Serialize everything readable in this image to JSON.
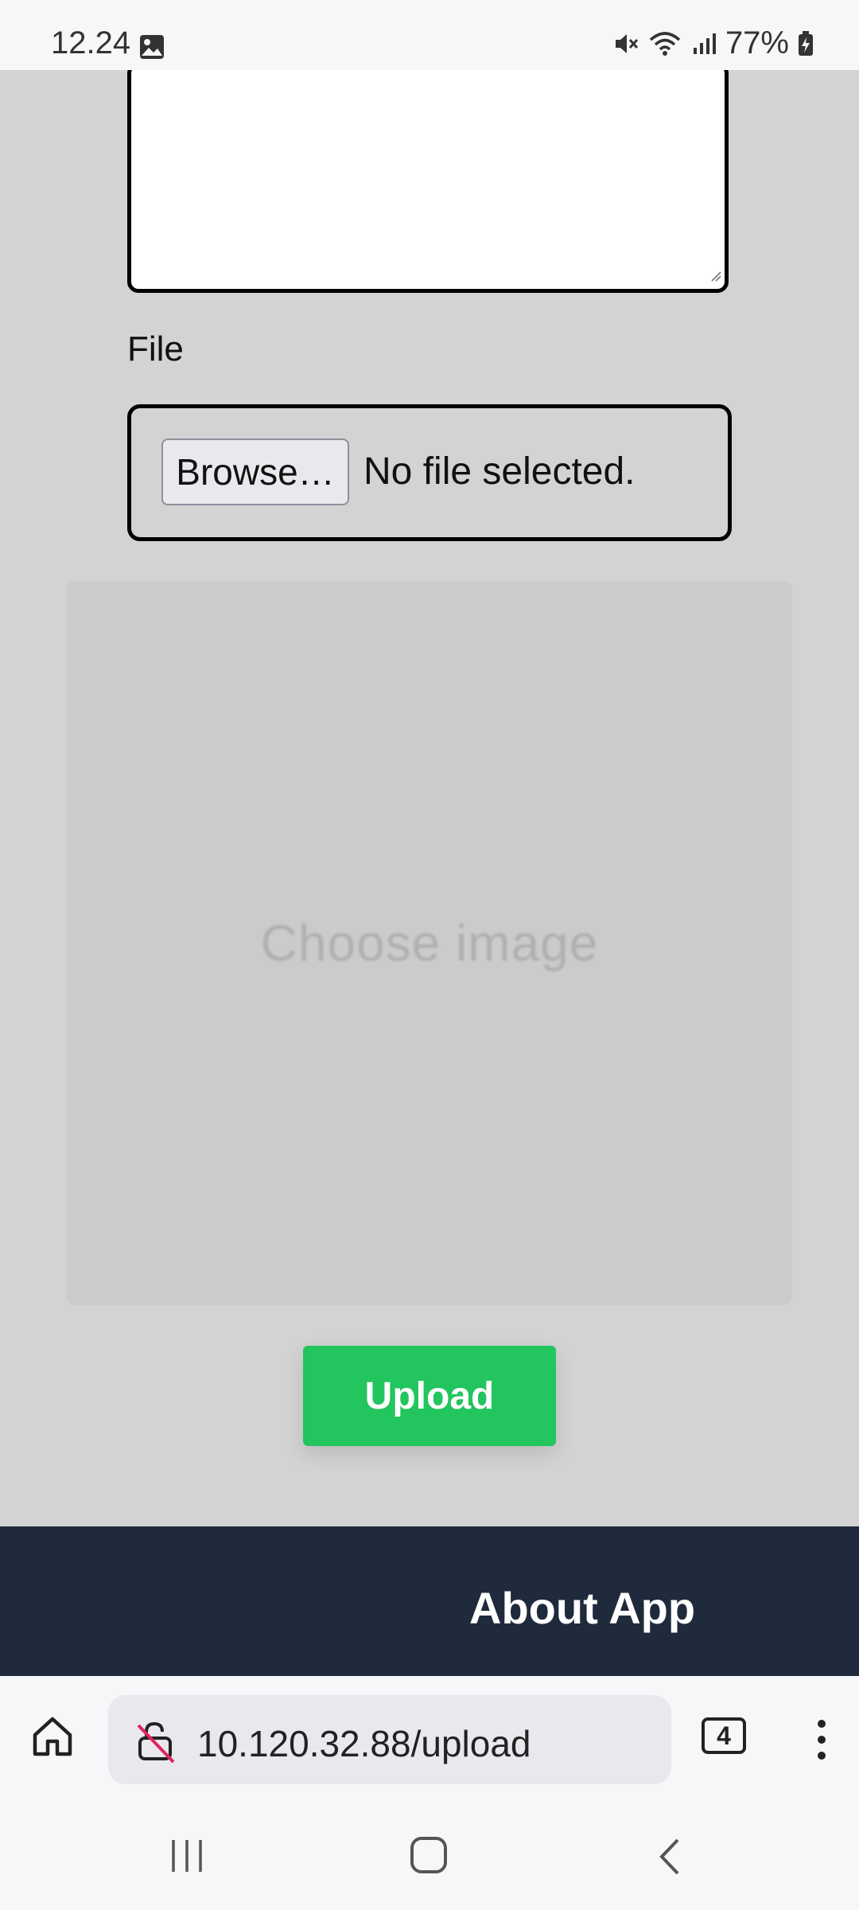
{
  "status_bar": {
    "time": "12.24",
    "battery": "77%",
    "icons": [
      "gallery-icon",
      "mute-icon",
      "wifi-icon",
      "signal-icon",
      "battery-icon"
    ]
  },
  "form": {
    "file_label": "File",
    "browse_label": "Browse…",
    "file_status": "No file selected.",
    "preview_placeholder": "Choose image",
    "upload_label": "Upload"
  },
  "footer": {
    "title": "About App"
  },
  "browser": {
    "url": "10.120.32.88/upload",
    "tab_count": "4"
  },
  "colors": {
    "page_bg": "#d3d3d3",
    "upload_button": "#22c55e",
    "footer_bg": "#1f2a3c"
  }
}
